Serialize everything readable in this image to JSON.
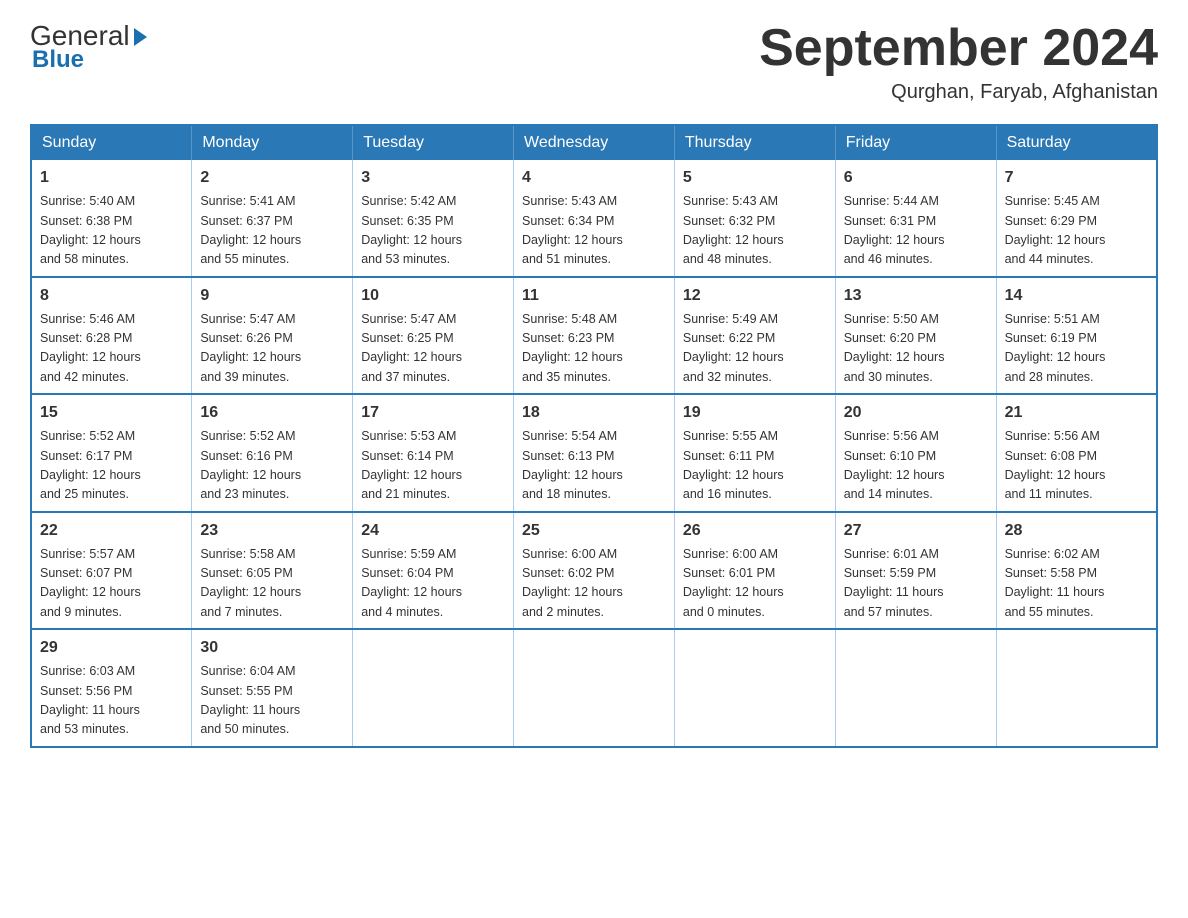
{
  "logo": {
    "general": "General",
    "blue": "Blue",
    "triangle": "▶"
  },
  "header": {
    "month_year": "September 2024",
    "location": "Qurghan, Faryab, Afghanistan"
  },
  "weekdays": [
    "Sunday",
    "Monday",
    "Tuesday",
    "Wednesday",
    "Thursday",
    "Friday",
    "Saturday"
  ],
  "weeks": [
    [
      {
        "day": "1",
        "info": "Sunrise: 5:40 AM\nSunset: 6:38 PM\nDaylight: 12 hours\nand 58 minutes."
      },
      {
        "day": "2",
        "info": "Sunrise: 5:41 AM\nSunset: 6:37 PM\nDaylight: 12 hours\nand 55 minutes."
      },
      {
        "day": "3",
        "info": "Sunrise: 5:42 AM\nSunset: 6:35 PM\nDaylight: 12 hours\nand 53 minutes."
      },
      {
        "day": "4",
        "info": "Sunrise: 5:43 AM\nSunset: 6:34 PM\nDaylight: 12 hours\nand 51 minutes."
      },
      {
        "day": "5",
        "info": "Sunrise: 5:43 AM\nSunset: 6:32 PM\nDaylight: 12 hours\nand 48 minutes."
      },
      {
        "day": "6",
        "info": "Sunrise: 5:44 AM\nSunset: 6:31 PM\nDaylight: 12 hours\nand 46 minutes."
      },
      {
        "day": "7",
        "info": "Sunrise: 5:45 AM\nSunset: 6:29 PM\nDaylight: 12 hours\nand 44 minutes."
      }
    ],
    [
      {
        "day": "8",
        "info": "Sunrise: 5:46 AM\nSunset: 6:28 PM\nDaylight: 12 hours\nand 42 minutes."
      },
      {
        "day": "9",
        "info": "Sunrise: 5:47 AM\nSunset: 6:26 PM\nDaylight: 12 hours\nand 39 minutes."
      },
      {
        "day": "10",
        "info": "Sunrise: 5:47 AM\nSunset: 6:25 PM\nDaylight: 12 hours\nand 37 minutes."
      },
      {
        "day": "11",
        "info": "Sunrise: 5:48 AM\nSunset: 6:23 PM\nDaylight: 12 hours\nand 35 minutes."
      },
      {
        "day": "12",
        "info": "Sunrise: 5:49 AM\nSunset: 6:22 PM\nDaylight: 12 hours\nand 32 minutes."
      },
      {
        "day": "13",
        "info": "Sunrise: 5:50 AM\nSunset: 6:20 PM\nDaylight: 12 hours\nand 30 minutes."
      },
      {
        "day": "14",
        "info": "Sunrise: 5:51 AM\nSunset: 6:19 PM\nDaylight: 12 hours\nand 28 minutes."
      }
    ],
    [
      {
        "day": "15",
        "info": "Sunrise: 5:52 AM\nSunset: 6:17 PM\nDaylight: 12 hours\nand 25 minutes."
      },
      {
        "day": "16",
        "info": "Sunrise: 5:52 AM\nSunset: 6:16 PM\nDaylight: 12 hours\nand 23 minutes."
      },
      {
        "day": "17",
        "info": "Sunrise: 5:53 AM\nSunset: 6:14 PM\nDaylight: 12 hours\nand 21 minutes."
      },
      {
        "day": "18",
        "info": "Sunrise: 5:54 AM\nSunset: 6:13 PM\nDaylight: 12 hours\nand 18 minutes."
      },
      {
        "day": "19",
        "info": "Sunrise: 5:55 AM\nSunset: 6:11 PM\nDaylight: 12 hours\nand 16 minutes."
      },
      {
        "day": "20",
        "info": "Sunrise: 5:56 AM\nSunset: 6:10 PM\nDaylight: 12 hours\nand 14 minutes."
      },
      {
        "day": "21",
        "info": "Sunrise: 5:56 AM\nSunset: 6:08 PM\nDaylight: 12 hours\nand 11 minutes."
      }
    ],
    [
      {
        "day": "22",
        "info": "Sunrise: 5:57 AM\nSunset: 6:07 PM\nDaylight: 12 hours\nand 9 minutes."
      },
      {
        "day": "23",
        "info": "Sunrise: 5:58 AM\nSunset: 6:05 PM\nDaylight: 12 hours\nand 7 minutes."
      },
      {
        "day": "24",
        "info": "Sunrise: 5:59 AM\nSunset: 6:04 PM\nDaylight: 12 hours\nand 4 minutes."
      },
      {
        "day": "25",
        "info": "Sunrise: 6:00 AM\nSunset: 6:02 PM\nDaylight: 12 hours\nand 2 minutes."
      },
      {
        "day": "26",
        "info": "Sunrise: 6:00 AM\nSunset: 6:01 PM\nDaylight: 12 hours\nand 0 minutes."
      },
      {
        "day": "27",
        "info": "Sunrise: 6:01 AM\nSunset: 5:59 PM\nDaylight: 11 hours\nand 57 minutes."
      },
      {
        "day": "28",
        "info": "Sunrise: 6:02 AM\nSunset: 5:58 PM\nDaylight: 11 hours\nand 55 minutes."
      }
    ],
    [
      {
        "day": "29",
        "info": "Sunrise: 6:03 AM\nSunset: 5:56 PM\nDaylight: 11 hours\nand 53 minutes."
      },
      {
        "day": "30",
        "info": "Sunrise: 6:04 AM\nSunset: 5:55 PM\nDaylight: 11 hours\nand 50 minutes."
      },
      null,
      null,
      null,
      null,
      null
    ]
  ]
}
